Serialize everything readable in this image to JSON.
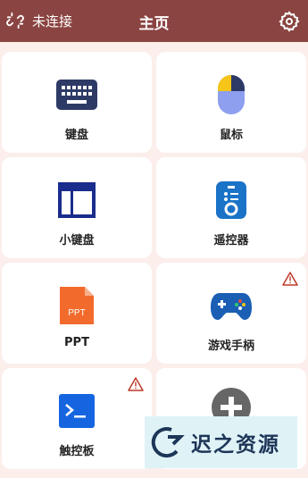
{
  "header": {
    "connection_status": "未连接",
    "title": "主页"
  },
  "cards": [
    {
      "label": "键盘"
    },
    {
      "label": "鼠标"
    },
    {
      "label": "小键盘"
    },
    {
      "label": "遥控器"
    },
    {
      "label": "PPT",
      "icon_text": "PPT"
    },
    {
      "label": "游戏手柄"
    },
    {
      "label": "触控板"
    },
    {
      "label": ""
    }
  ],
  "watermark": {
    "text": "迟之资源"
  },
  "colors": {
    "header": "#8a4441",
    "background": "#fbeeeb",
    "card": "#ffffff",
    "accent_blue": "#1a2c8c",
    "ppt_orange": "#f26b2d",
    "warn_red": "#c0392b"
  }
}
